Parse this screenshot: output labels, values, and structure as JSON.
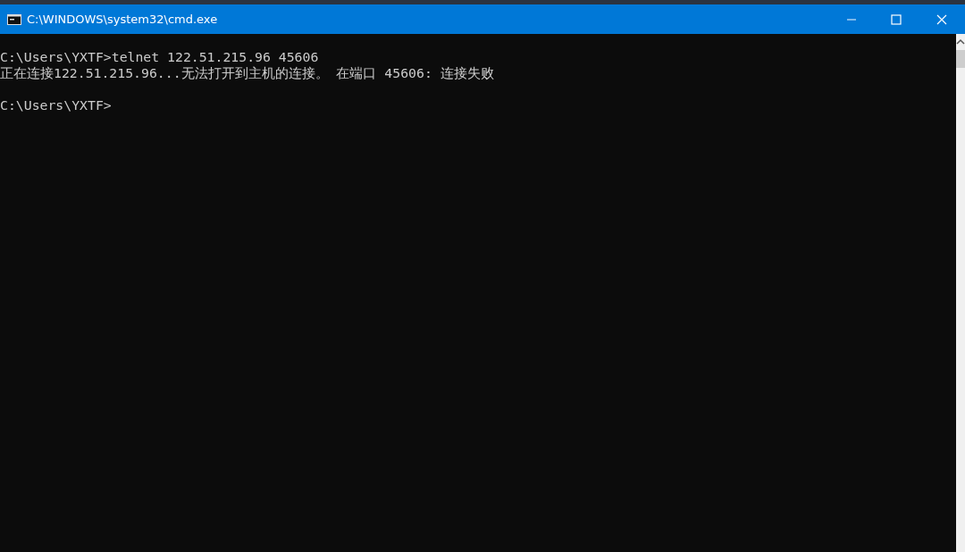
{
  "window": {
    "title": "C:\\WINDOWS\\system32\\cmd.exe"
  },
  "console": {
    "blocks": [
      {
        "lines": [
          "C:\\Users\\YXTF>telnet 122.51.215.96 45606",
          "正在连接122.51.215.96...无法打开到主机的连接。 在端口 45606: 连接失败"
        ]
      },
      {
        "lines": [
          "C:\\Users\\YXTF>"
        ]
      }
    ]
  }
}
